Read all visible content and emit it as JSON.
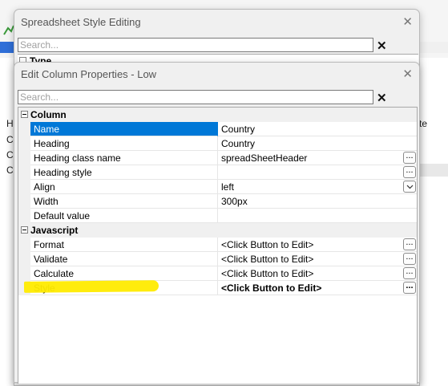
{
  "background": {
    "left_row_labels": [
      "H",
      "Co",
      "Ci",
      "Co"
    ],
    "right_header_fragment": "te"
  },
  "back_dialog": {
    "title": "Spreadsheet Style Editing",
    "search_placeholder": "Search...",
    "category_label": "Type"
  },
  "front_dialog": {
    "title": "Edit Column Properties - Low",
    "search_placeholder": "Search...",
    "categories": [
      {
        "label": "Column",
        "rows": [
          {
            "name": "Name",
            "value": "Country",
            "button": "none",
            "selected": true
          },
          {
            "name": "Heading",
            "value": "Country",
            "button": "none"
          },
          {
            "name": "Heading class name",
            "value": "spreadSheetHeader",
            "button": "ellipsis"
          },
          {
            "name": "Heading style",
            "value": "",
            "button": "ellipsis"
          },
          {
            "name": "Align",
            "value": "left",
            "button": "dropdown"
          },
          {
            "name": "Width",
            "value": "300px",
            "button": "none"
          },
          {
            "name": "Default value",
            "value": "",
            "button": "none"
          }
        ]
      },
      {
        "label": "Javascript",
        "rows": [
          {
            "name": "Format",
            "value": "<Click Button to Edit>",
            "button": "ellipsis"
          },
          {
            "name": "Validate",
            "value": "<Click Button to Edit>",
            "button": "ellipsis"
          },
          {
            "name": "Calculate",
            "value": "<Click Button to Edit>",
            "button": "ellipsis"
          },
          {
            "name": "Style",
            "value": "<Click Button to Edit>",
            "button": "ellipsis",
            "bold": true
          }
        ]
      }
    ],
    "ellipsis_label": "...",
    "close_glyph": "✕",
    "clear_glyph": "✕"
  },
  "colors": {
    "selection": "#0078d7",
    "highlight": "#ffeb00",
    "dialog_bg": "#f0f0f0"
  }
}
